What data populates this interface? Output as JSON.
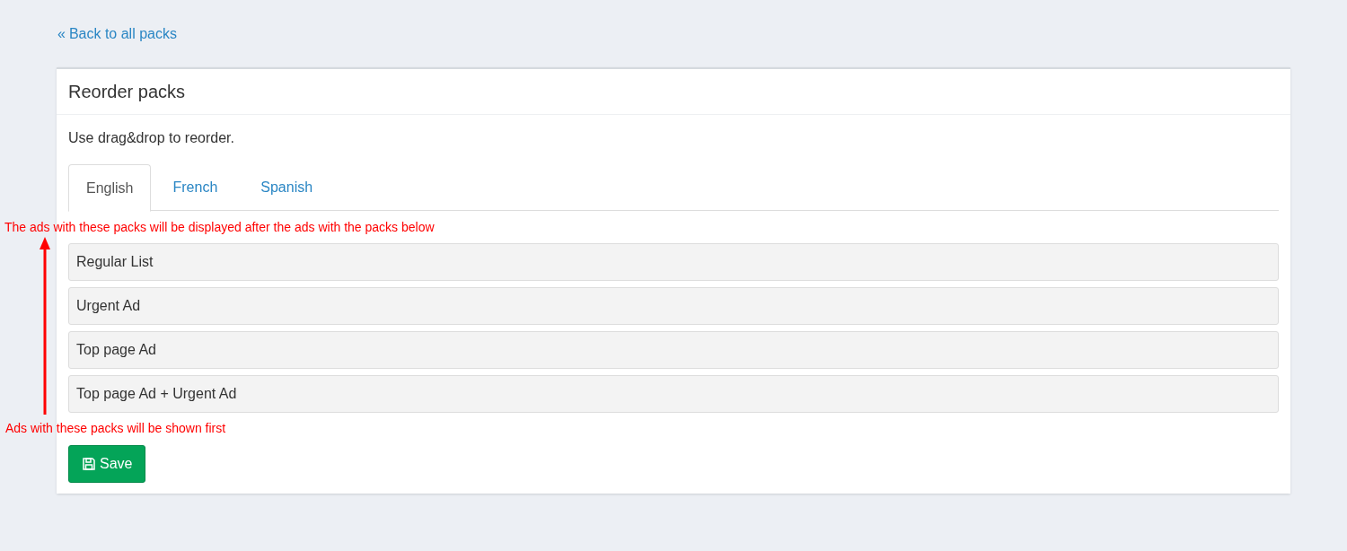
{
  "back_link": {
    "icon": "«",
    "label": "Back to all packs"
  },
  "card": {
    "title": "Reorder packs",
    "hint": "Use drag&drop to reorder."
  },
  "tabs": [
    {
      "label": "English",
      "selected": true
    },
    {
      "label": "French",
      "selected": false
    },
    {
      "label": "Spanish",
      "selected": false
    }
  ],
  "packs": [
    "Regular List",
    "Urgent Ad",
    "Top page Ad",
    "Top page Ad + Urgent Ad"
  ],
  "save_button": {
    "label": "Save"
  },
  "annotations": {
    "top": "The ads with these packs will be displayed after the ads with the packs below",
    "bottom": "Ads with these packs will be shown first"
  }
}
